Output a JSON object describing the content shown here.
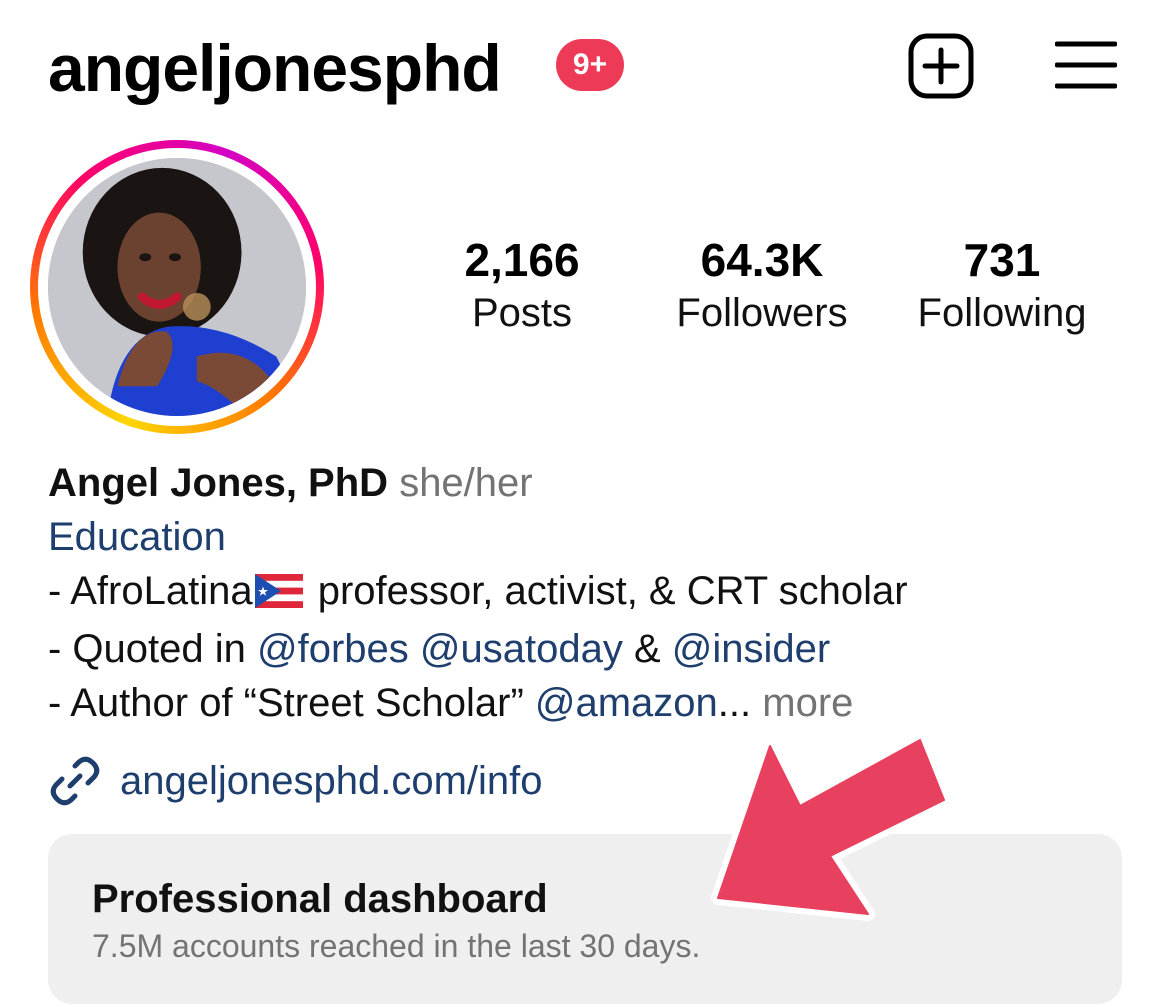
{
  "header": {
    "username": "angeljonesphd",
    "notification_badge": "9+",
    "new_post_icon": "plus-square-icon",
    "menu_icon": "hamburger-menu-icon"
  },
  "profile": {
    "avatar_icon": "profile-photo"
  },
  "stats": {
    "posts": {
      "value": "2,166",
      "label": "Posts"
    },
    "followers": {
      "value": "64.3K",
      "label": "Followers"
    },
    "following": {
      "value": "731",
      "label": "Following"
    }
  },
  "bio": {
    "name": "Angel Jones, PhD",
    "pronouns": "she/her",
    "category": "Education",
    "line1_prefix": "- AfroLatina",
    "line1_suffix": " professor, activist, & CRT scholar",
    "line2_prefix": "- Quoted in ",
    "line2_mention1": "@forbes",
    "line2_mention2": "@usatoday",
    "line2_amp": " & ",
    "line2_mention3": "@insider",
    "line3_prefix": "- Author of “Street Scholar” ",
    "line3_mention": "@amazon",
    "line3_ellipsis": "...",
    "more_label": "more",
    "flag_icon": "puerto-rico-flag-icon"
  },
  "link": {
    "icon": "link-icon",
    "url": "angeljonesphd.com/info"
  },
  "dashboard": {
    "title": "Professional dashboard",
    "subtitle": "7.5M accounts reached in the last 30 days."
  },
  "colors": {
    "badge": "#ed3b57",
    "link_blue": "#1e3e6d",
    "muted": "#737373",
    "card_bg": "#efefef",
    "arrow": "#e8405f"
  }
}
